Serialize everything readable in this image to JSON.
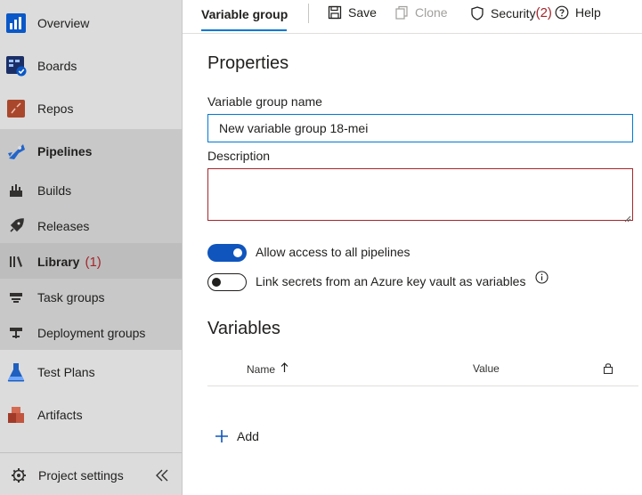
{
  "sidebar": {
    "items": [
      {
        "id": "overview",
        "label": "Overview",
        "icon": "overview-icon"
      },
      {
        "id": "boards",
        "label": "Boards",
        "icon": "boards-icon"
      },
      {
        "id": "repos",
        "label": "Repos",
        "icon": "repos-icon"
      },
      {
        "id": "pipelines",
        "label": "Pipelines",
        "icon": "pipelines-icon"
      },
      {
        "id": "builds",
        "label": "Builds",
        "icon": "builds-icon"
      },
      {
        "id": "releases",
        "label": "Releases",
        "icon": "releases-icon"
      },
      {
        "id": "library",
        "label": "Library",
        "icon": "library-icon",
        "annotation": "(1)"
      },
      {
        "id": "task-groups",
        "label": "Task groups",
        "icon": "task-groups-icon"
      },
      {
        "id": "deployment-groups",
        "label": "Deployment groups",
        "icon": "deployment-groups-icon"
      },
      {
        "id": "test-plans",
        "label": "Test Plans",
        "icon": "test-plans-icon"
      },
      {
        "id": "artifacts",
        "label": "Artifacts",
        "icon": "artifacts-icon"
      }
    ],
    "footer": {
      "label": "Project settings",
      "icon": "gear-icon",
      "collapse_icon": "double-chevron-left-icon"
    }
  },
  "toolbar": {
    "tab_label": "Variable group",
    "save_label": "Save",
    "clone_label": "Clone",
    "security_label": "Security",
    "security_annotation": "(2)",
    "help_label": "Help"
  },
  "properties": {
    "heading": "Properties",
    "name_label": "Variable group name",
    "name_value": "New variable group 18-mei",
    "description_label": "Description",
    "description_value": "",
    "toggle_pipelines_label": "Allow access to all pipelines",
    "toggle_pipelines_on": true,
    "toggle_keyvault_label": "Link secrets from an Azure key vault as variables",
    "toggle_keyvault_on": false
  },
  "variables": {
    "heading": "Variables",
    "col_name": "Name",
    "col_value": "Value",
    "add_label": "Add"
  },
  "colors": {
    "accent": "#0078d4",
    "toggle_on": "#0f55bd",
    "error_border": "#a4262c",
    "annotation": "#a4262c",
    "sidebar_bg": "#dcdcdc"
  }
}
